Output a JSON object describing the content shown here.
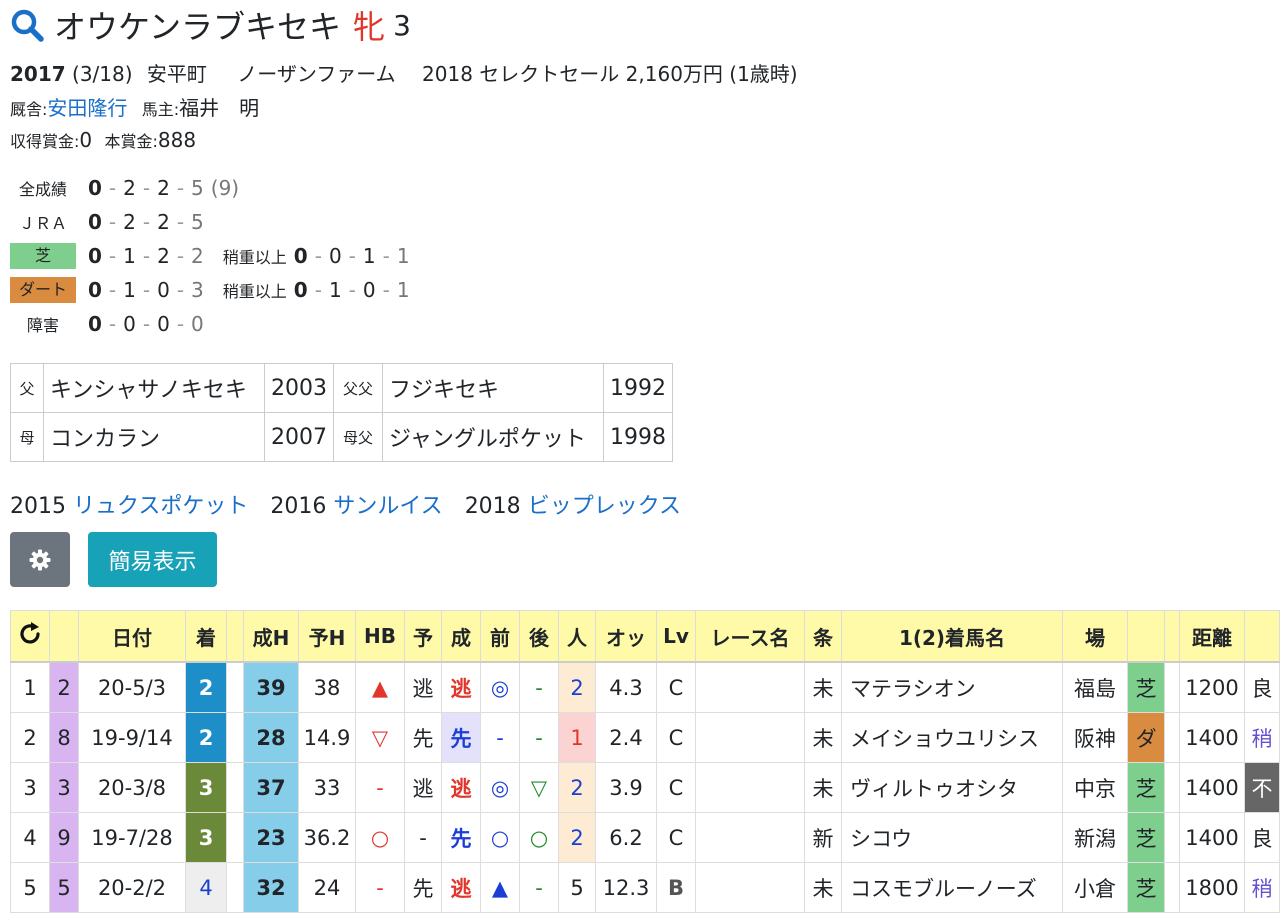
{
  "header": {
    "horse_name": "オウケンラブキセキ",
    "sex": "牝",
    "age": "3"
  },
  "info": {
    "birth_year": "2017",
    "birth_date": "(3/18)",
    "birthplace": "安平町",
    "farm": "ノーザンファーム",
    "sale": "2018 セレクトセール 2,160万円 (1歳時)",
    "stable_label": "厩舎:",
    "trainer": "安田隆行",
    "owner_label": "馬主:",
    "owner": "福井　明",
    "earned_label": "収得賞金:",
    "earned": "0",
    "prize_label": "本賞金:",
    "prize": "888"
  },
  "records": [
    {
      "label": "全成績",
      "n": [
        "0",
        "2",
        "2",
        "5"
      ],
      "extra": "(9)"
    },
    {
      "label": "ＪＲＡ",
      "n": [
        "0",
        "2",
        "2",
        "5"
      ]
    },
    {
      "label": "芝",
      "n": [
        "0",
        "1",
        "2",
        "2"
      ],
      "sub": "稍重以上",
      "sn": [
        "0",
        "0",
        "1",
        "1"
      ]
    },
    {
      "label": "ダート",
      "n": [
        "0",
        "1",
        "0",
        "3"
      ],
      "sub": "稍重以上",
      "sn": [
        "0",
        "1",
        "0",
        "1"
      ]
    },
    {
      "label": "障害",
      "n": [
        "0",
        "0",
        "0",
        "0"
      ]
    }
  ],
  "pedigree": {
    "sire_label": "父",
    "sire": "キンシャサノキセキ",
    "sire_year": "2003",
    "sire_sire_label": "父父",
    "sire_sire": "フジキセキ",
    "sire_sire_year": "1992",
    "dam_label": "母",
    "dam": "コンカラン",
    "dam_year": "2007",
    "dam_sire_label": "母父",
    "dam_sire": "ジャングルポケット",
    "dam_sire_year": "1998"
  },
  "siblings": [
    {
      "year": "2015",
      "name": "リュクスポケット"
    },
    {
      "year": "2016",
      "name": "サンルイス"
    },
    {
      "year": "2018",
      "name": "ビップレックス"
    }
  ],
  "buttons": {
    "gear_icon": "gear-icon",
    "simple_label": "簡易表示"
  },
  "table": {
    "refresh_icon": "refresh-icon",
    "headers": [
      "",
      "日付",
      "着",
      "",
      "成H",
      "予H",
      "HB",
      "予",
      "成",
      "前",
      "後",
      "人",
      "オッ",
      "Lv",
      "レース名",
      "条",
      "1(2)着馬名",
      "場",
      "",
      "",
      "距離",
      ""
    ],
    "rows": [
      {
        "no": "1",
        "gate": "2",
        "date": "20-5/3",
        "finish": "2",
        "seiH": "39",
        "yoH": "38",
        "hb": "▲",
        "yo": "逃",
        "sei": "逃",
        "mae": "◎",
        "ato": "-",
        "pop": "2",
        "odds": "4.3",
        "lv": "C",
        "race": "",
        "cond": "未",
        "winner": "マテラシオン",
        "place": "福島",
        "surface": "芝",
        "dist": "1200",
        "going": "良"
      },
      {
        "no": "2",
        "gate": "8",
        "date": "19-9/14",
        "finish": "2",
        "seiH": "28",
        "yoH": "14.9",
        "hb": "▽",
        "yo": "先",
        "sei": "先",
        "mae": "-",
        "ato": "-",
        "pop": "1",
        "odds": "2.4",
        "lv": "C",
        "race": "",
        "cond": "未",
        "winner": "メイショウユリシス",
        "place": "阪神",
        "surface": "ダ",
        "dist": "1400",
        "going": "稍"
      },
      {
        "no": "3",
        "gate": "3",
        "date": "20-3/8",
        "finish": "3",
        "seiH": "37",
        "yoH": "33",
        "hb": "-",
        "yo": "逃",
        "sei": "逃",
        "mae": "◎",
        "ato": "▽",
        "pop": "2",
        "odds": "3.9",
        "lv": "C",
        "race": "",
        "cond": "未",
        "winner": "ヴィルトゥオシタ",
        "place": "中京",
        "surface": "芝",
        "dist": "1400",
        "going": "不"
      },
      {
        "no": "4",
        "gate": "9",
        "date": "19-7/28",
        "finish": "3",
        "seiH": "23",
        "yoH": "36.2",
        "hb": "○",
        "yo": "-",
        "sei": "先",
        "mae": "○",
        "ato": "○",
        "pop": "2",
        "odds": "6.2",
        "lv": "C",
        "race": "",
        "cond": "新",
        "winner": "シコウ",
        "place": "新潟",
        "surface": "芝",
        "dist": "1400",
        "going": "良"
      },
      {
        "no": "5",
        "gate": "5",
        "date": "20-2/2",
        "finish": "4",
        "seiH": "32",
        "yoH": "24",
        "hb": "-",
        "yo": "先",
        "sei": "逃",
        "mae": "▲",
        "ato": "-",
        "pop": "5",
        "odds": "12.3",
        "lv": "B",
        "race": "",
        "cond": "未",
        "winner": "コスモブルーノーズ",
        "place": "小倉",
        "surface": "芝",
        "dist": "1800",
        "going": "稍"
      }
    ]
  },
  "colors": {
    "link": "#1a6fc9",
    "header_bg": "#fffaa8",
    "turf": "#7ecf8e",
    "dirt": "#d98c40",
    "gate_purple": "#d8b4f0",
    "finish2": "#1e8ec9",
    "finish3": "#6a8a3a",
    "seiH": "#86cdea"
  }
}
